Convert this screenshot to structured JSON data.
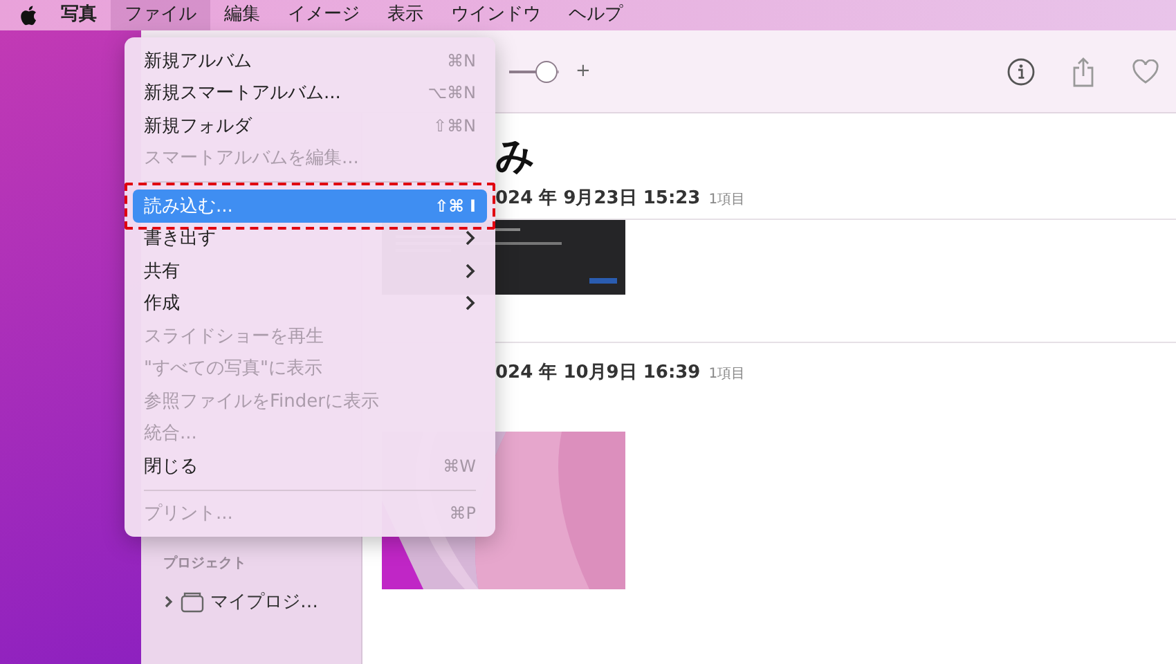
{
  "menubar": {
    "items": [
      {
        "label": "写真",
        "kind": "app",
        "selected": false
      },
      {
        "label": "ファイル",
        "kind": "menu",
        "selected": true
      },
      {
        "label": "編集",
        "kind": "menu",
        "selected": false
      },
      {
        "label": "イメージ",
        "kind": "menu",
        "selected": false
      },
      {
        "label": "表示",
        "kind": "menu",
        "selected": false
      },
      {
        "label": "ウインドウ",
        "kind": "menu",
        "selected": false
      },
      {
        "label": "ヘルプ",
        "kind": "menu",
        "selected": false
      }
    ]
  },
  "toolbar": {
    "zoom_slider": {
      "level": 0.75
    },
    "zoom_in": "+"
  },
  "sidebar": {
    "section": "プロジェクト",
    "items": [
      {
        "label": "マイプロジ…",
        "expanded": false
      }
    ]
  },
  "content": {
    "title": "み",
    "groups": [
      {
        "date": "024 年 9月23日 15:23",
        "count": "1項目"
      },
      {
        "date": "024 年 10月9日 16:39",
        "count": "1項目"
      }
    ]
  },
  "file_menu": {
    "items": [
      {
        "kind": "item",
        "label": "新規アルバム",
        "shortcut": "⌘N",
        "submenu": false,
        "disabled": false,
        "selected": false,
        "outlined": false
      },
      {
        "kind": "item",
        "label": "新規スマートアルバム...",
        "shortcut": "⌥⌘N",
        "submenu": false,
        "disabled": false,
        "selected": false,
        "outlined": false
      },
      {
        "kind": "item",
        "label": "新規フォルダ",
        "shortcut": "⇧⌘N",
        "submenu": false,
        "disabled": false,
        "selected": false,
        "outlined": false
      },
      {
        "kind": "item",
        "label": "スマートアルバムを編集...",
        "submenu": false,
        "disabled": true,
        "selected": false,
        "outlined": false
      },
      {
        "kind": "separator"
      },
      {
        "kind": "item",
        "label": "読み込む...",
        "shortcut": "⇧⌘ I",
        "submenu": false,
        "disabled": false,
        "selected": true,
        "outlined": true
      },
      {
        "kind": "item",
        "label": "書き出す",
        "submenu": true,
        "disabled": false,
        "selected": false,
        "outlined": false
      },
      {
        "kind": "item",
        "label": "共有",
        "submenu": true,
        "disabled": false,
        "selected": false,
        "outlined": false
      },
      {
        "kind": "item",
        "label": "作成",
        "submenu": true,
        "disabled": false,
        "selected": false,
        "outlined": false
      },
      {
        "kind": "item",
        "label": "スライドショーを再生",
        "submenu": false,
        "disabled": true,
        "selected": false,
        "outlined": false
      },
      {
        "kind": "item",
        "label": "\"すべての写真\"に表示",
        "submenu": false,
        "disabled": true,
        "selected": false,
        "outlined": false
      },
      {
        "kind": "item",
        "label": "参照ファイルをFinderに表示",
        "submenu": false,
        "disabled": true,
        "selected": false,
        "outlined": false
      },
      {
        "kind": "item",
        "label": "統合...",
        "submenu": false,
        "disabled": true,
        "selected": false,
        "outlined": false
      },
      {
        "kind": "item",
        "label": "閉じる",
        "shortcut": "⌘W",
        "submenu": false,
        "disabled": false,
        "selected": false,
        "outlined": false
      },
      {
        "kind": "separator"
      },
      {
        "kind": "item",
        "label": "プリント...",
        "shortcut": "⌘P",
        "submenu": false,
        "disabled": true,
        "selected": false,
        "outlined": false
      }
    ]
  }
}
